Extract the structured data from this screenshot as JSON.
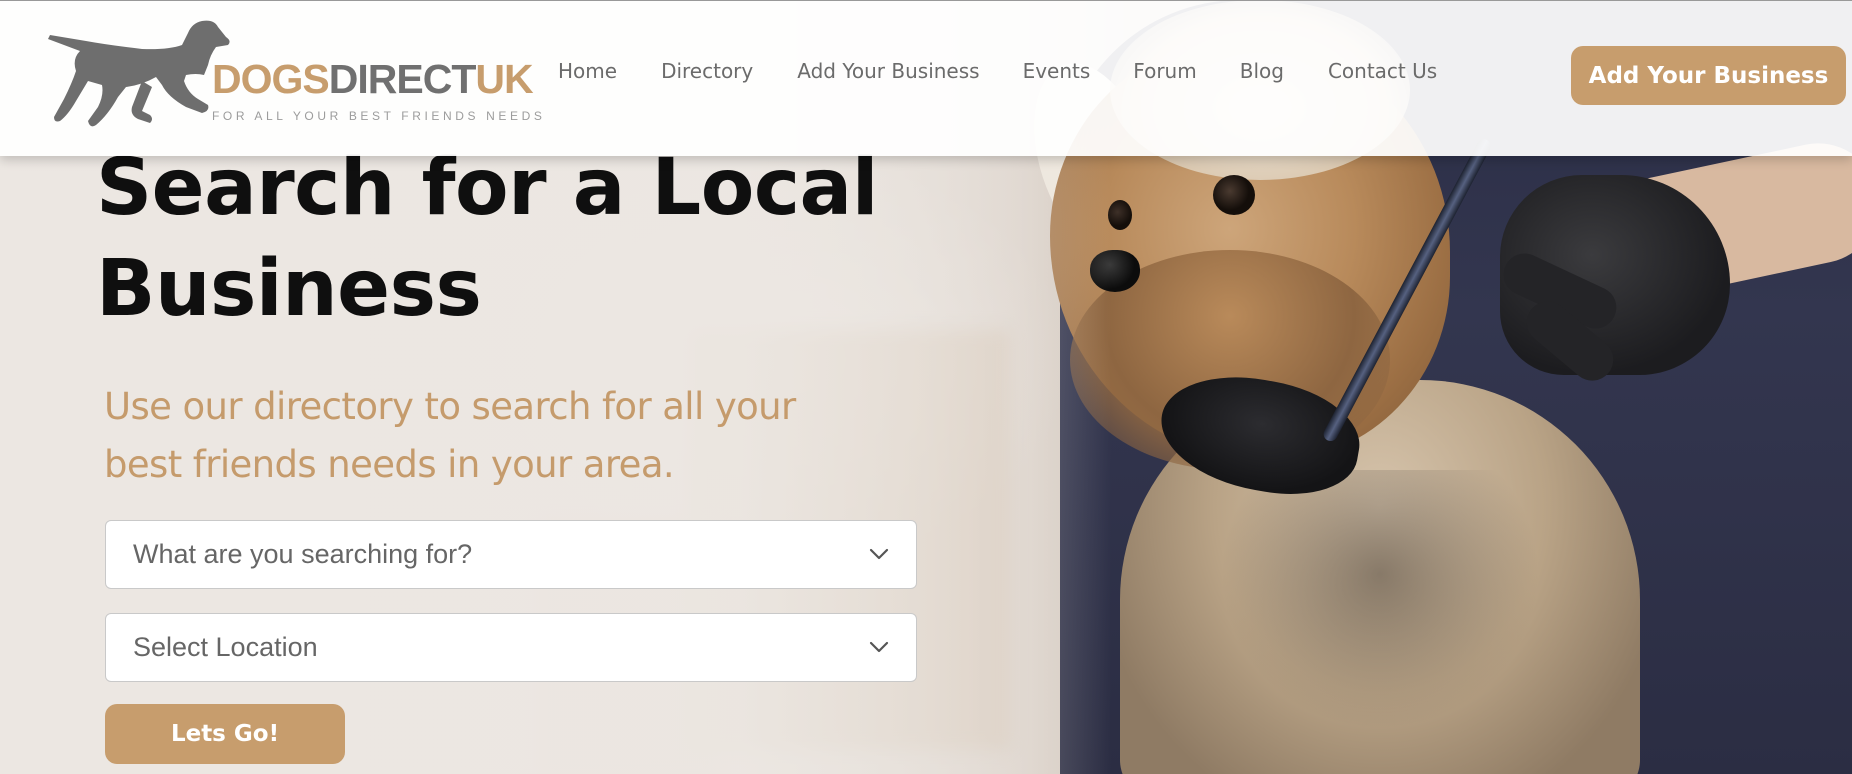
{
  "brand": {
    "word_part1": "DOGS",
    "word_part2": "DIRECT",
    "word_part3": "UK",
    "tagline": "FOR ALL YOUR BEST FRIENDS NEEDS",
    "accent_color": "#c79d6d",
    "grey_color": "#707070",
    "logo_icon": "running-dog-icon"
  },
  "nav": {
    "items": [
      {
        "label": "Home"
      },
      {
        "label": "Directory"
      },
      {
        "label": "Add Your Business"
      },
      {
        "label": "Events"
      },
      {
        "label": "Forum"
      },
      {
        "label": "Blog"
      },
      {
        "label": "Contact Us"
      }
    ],
    "cta_label": "Add Your Business"
  },
  "hero": {
    "title_line1": "Search for a Local",
    "title_line2": "Business",
    "subtitle_line1": "Use our directory to search for all your",
    "subtitle_line2": "best friends needs in your area.",
    "search_select": {
      "value": "What are you searching for?",
      "icon": "chevron-down-icon"
    },
    "location_select": {
      "value": "Select Location",
      "icon": "chevron-down-icon"
    },
    "button_label": "Lets Go!",
    "background_image": "groomer trimming yorkshire terrier with scissors"
  }
}
